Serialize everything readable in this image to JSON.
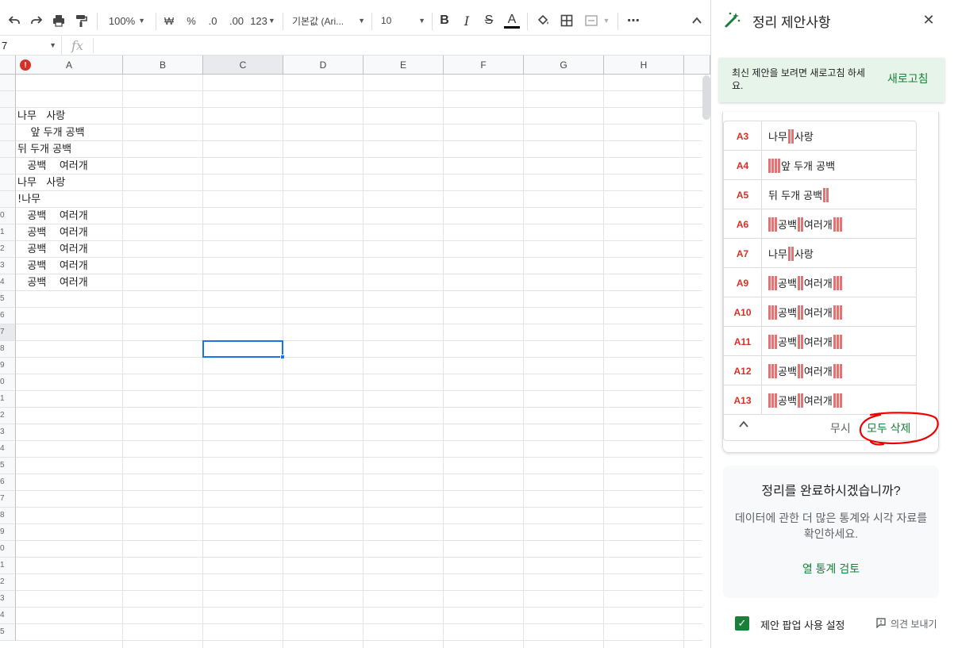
{
  "toolbar": {
    "undo_icon": "undo-icon",
    "redo_icon": "redo-icon",
    "print_icon": "print-icon",
    "paint_format_icon": "paint-format-icon",
    "zoom": "100%",
    "currency": "₩",
    "percent": "%",
    "decrease_decimal": ".0",
    "increase_decimal": ".00",
    "number_format": "123",
    "font": "기본값 (Ari...",
    "font_size": "10",
    "bold": "B",
    "italic": "I",
    "strikethrough": "S",
    "text_color": "A",
    "more": "⋯"
  },
  "formula_bar": {
    "name_box": "7",
    "fx": "fx"
  },
  "grid": {
    "columns": [
      "A",
      "B",
      "C",
      "D",
      "E",
      "F",
      "G",
      "H"
    ],
    "row_labels": [
      "",
      "",
      "",
      "",
      "",
      "",
      "",
      "",
      "0",
      "1",
      "2",
      "3",
      "4",
      "5",
      "6",
      "7",
      "8",
      "9",
      "0",
      "1",
      "2",
      "3",
      "4",
      "5",
      "6",
      "7",
      "8",
      "9",
      "0",
      "1",
      "2",
      "3",
      "4",
      "5"
    ],
    "cells": [
      "",
      "",
      "나무   사랑",
      "    앞 두개 공백",
      "뒤 두개 공백  ",
      "   공백    여러개   ",
      "나무   사랑",
      "!나무",
      "   공백    여러개   ",
      "   공백    여러개   ",
      "   공백    여러개   ",
      "   공백    여러개   ",
      "   공백    여러개   "
    ],
    "active_column": "C",
    "active_row_label": "7"
  },
  "panel": {
    "title": "정리 제안사항",
    "refresh_message": "최신 제안을 보려면 새로고침 하세요.",
    "refresh_button": "새로고침",
    "suggestions": [
      {
        "ref": "A3",
        "segments": [
          {
            "t": "나무 "
          },
          {
            "s": 2
          },
          {
            "t": "사랑"
          }
        ]
      },
      {
        "ref": "A4",
        "segments": [
          {
            "s": 4
          },
          {
            "t": "앞 두개 공백"
          }
        ]
      },
      {
        "ref": "A5",
        "segments": [
          {
            "t": "뒤 두개 공백"
          },
          {
            "s": 2
          }
        ]
      },
      {
        "ref": "A6",
        "segments": [
          {
            "s": 3
          },
          {
            "t": "공백 "
          },
          {
            "s": 2
          },
          {
            "t": "여러개"
          },
          {
            "s": 3
          }
        ]
      },
      {
        "ref": "A7",
        "segments": [
          {
            "t": "나무 "
          },
          {
            "s": 2
          },
          {
            "t": "사랑"
          }
        ]
      },
      {
        "ref": "A9",
        "segments": [
          {
            "s": 3
          },
          {
            "t": "공백 "
          },
          {
            "s": 2
          },
          {
            "t": "여러개"
          },
          {
            "s": 3
          }
        ]
      },
      {
        "ref": "A10",
        "segments": [
          {
            "s": 3
          },
          {
            "t": "공백 "
          },
          {
            "s": 2
          },
          {
            "t": "여러개"
          },
          {
            "s": 3
          }
        ]
      },
      {
        "ref": "A11",
        "segments": [
          {
            "s": 3
          },
          {
            "t": "공백 "
          },
          {
            "s": 2
          },
          {
            "t": "여러개"
          },
          {
            "s": 3
          }
        ]
      },
      {
        "ref": "A12",
        "segments": [
          {
            "s": 3
          },
          {
            "t": "공백 "
          },
          {
            "s": 2
          },
          {
            "t": "여러개"
          },
          {
            "s": 3
          }
        ]
      },
      {
        "ref": "A13",
        "segments": [
          {
            "s": 3
          },
          {
            "t": "공백 "
          },
          {
            "s": 2
          },
          {
            "t": "여러개"
          },
          {
            "s": 3
          }
        ]
      }
    ],
    "ignore_button": "무시",
    "delete_all_button": "모두 삭제",
    "finish_title": "정리를 완료하시겠습니까?",
    "finish_description": "데이터에 관한 더 많은 통계와 시각 자료를 확인하세요.",
    "column_stats_button": "열 통계 검토",
    "popup_setting_label": "제안 팝업 사용 설정",
    "popup_setting_checked": true,
    "feedback_label": "의견 보내기"
  },
  "colors": {
    "accent_green": "#188038",
    "error_red": "#d93025",
    "space_marker": "#e57373",
    "selection_blue": "#1a73e8",
    "banner_green": "#e6f4ea"
  }
}
